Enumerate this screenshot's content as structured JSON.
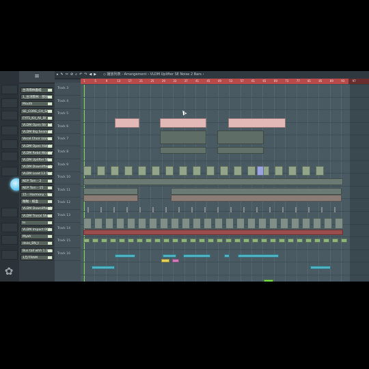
{
  "toolbar": {
    "tools": [
      "▸",
      "✎",
      "✂",
      "⊘",
      "⌕",
      "↶",
      "↷",
      "◀",
      "▶"
    ],
    "window_title": "◇ 播放列表 - Arrangement › VLDM Uplifter SE Noise 2 Bars ›"
  },
  "rack": {
    "title": "≡",
    "channels": [
      "台湾雨林蟲蛙",
      "1_台湾雨林 - 部分",
      "Mouth",
      "SE_CORE_CH_SAM",
      "FYF5_Kit_Ali_Bl",
      "VLDM Open Str 1:1",
      "VLDM Big Seam 12",
      "Vocal Choir (some",
      "VLDM Open Hat 08",
      "VLDM Rebd Wood AI",
      "VLDM Uplifter SE",
      "VLDM Downlifter 14",
      "VLDM Load 13 Tech Dr",
      "NEP Tom - 2",
      "NEP Tom - 15",
      "15 - Harmony - BJ",
      "啪啪 - 紙盒",
      "VLDM Downlifter 19",
      "VLDM Tronal Shout",
      "In",
      "VLDM Impact 003",
      "Myah",
      "dezo_BN_t",
      "Bus tall whh 1.3 dg",
      "1万/TRAM"
    ]
  },
  "track_labels": [
    "Track 3",
    "Track 4",
    "Track 5",
    "Track 6",
    "Track 7",
    "Track 8",
    "Track 9",
    "Track 10",
    "Track 11",
    "Track 12",
    "Track 13",
    "Track 14",
    "Track 15",
    "Track 16"
  ],
  "ruler_ticks": [
    "1",
    "5",
    "9",
    "13",
    "17",
    "21",
    "25",
    "29",
    "33",
    "37",
    "41",
    "45",
    "49",
    "53",
    "57",
    "61",
    "65",
    "69",
    "73",
    "77",
    "81",
    "85",
    "89",
    "93",
    "97"
  ],
  "colors": {
    "accent_ruler": "#b84b4a",
    "playhead": "#7ddc4a",
    "vocal_clip": "#e3b9b8",
    "pattern_green": "#8fb57e",
    "pattern_teal": "#4fb1c2"
  }
}
